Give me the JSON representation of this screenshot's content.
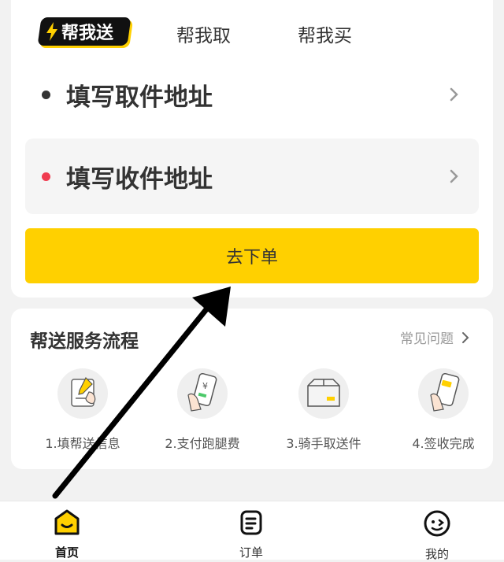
{
  "tabs": {
    "active_label": "帮我送",
    "items": [
      "帮我取",
      "帮我买"
    ]
  },
  "address": {
    "pickup_label": "填写取件地址",
    "dropoff_label": "填写收件地址",
    "pickup_dot_color": "#333333",
    "dropoff_dot_color": "#f03c50"
  },
  "order_button": {
    "label": "去下单",
    "color": "#ffd000"
  },
  "flow": {
    "title": "帮送服务流程",
    "faq_label": "常见问题",
    "steps": [
      {
        "label": "1.填帮送信息",
        "icon": "fill-form-icon"
      },
      {
        "label": "2.支付跑腿费",
        "icon": "payment-phone-icon"
      },
      {
        "label": "3.骑手取送件",
        "icon": "package-box-icon"
      },
      {
        "label": "4.签收完成",
        "icon": "sign-phone-icon"
      }
    ]
  },
  "bottom_nav": {
    "items": [
      {
        "label": "首页",
        "icon": "home-icon",
        "active": true
      },
      {
        "label": "订单",
        "icon": "orders-icon",
        "active": false
      },
      {
        "label": "我的",
        "icon": "profile-icon",
        "active": false
      }
    ]
  },
  "overlay": {
    "arrow": "annotation-arrow",
    "color": "#000000"
  }
}
